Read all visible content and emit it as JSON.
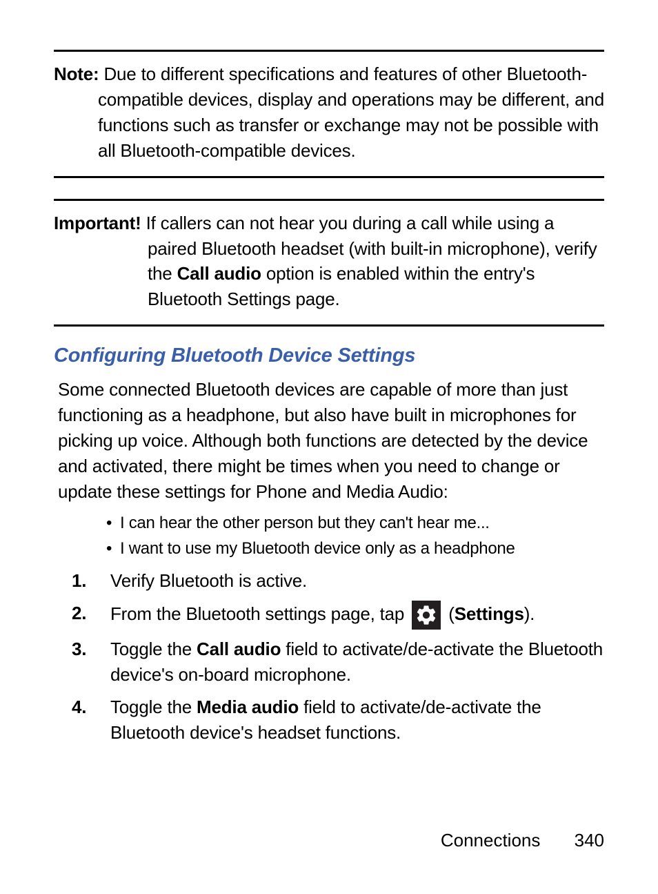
{
  "note": {
    "label": "Note:",
    "line1_after": " Due to different specifications and features of other Bluetooth-",
    "line2": "compatible devices, display and operations may be different, and functions such as transfer or exchange may not be possible with all Bluetooth-compatible devices."
  },
  "important": {
    "label": "Important!",
    "line1_after": " If callers can not hear you during a call while using a",
    "line2_before": "paired Bluetooth headset (with built-in microphone), verify the ",
    "call_audio": "Call audio",
    "line2_after": " option is enabled within the entry's Bluetooth Settings page."
  },
  "heading": "Configuring Bluetooth Device Settings",
  "intro": "Some connected Bluetooth devices are capable of more than just functioning as a headphone, but also have built in microphones for picking up voice. Although both functions are detected by the device and activated, there might be times when you need to change or update these settings for Phone and Media Audio:",
  "bullets": [
    "I can hear the other person but they can't hear me...",
    "I want to use my Bluetooth device only as a headphone"
  ],
  "steps": {
    "s1": {
      "num": "1.",
      "text": "Verify Bluetooth is active."
    },
    "s2": {
      "num": "2.",
      "before": "From the Bluetooth settings page, tap ",
      "paren_open": " (",
      "settings_bold": "Settings",
      "paren_close": ")."
    },
    "s3": {
      "num": "3.",
      "before": "Toggle the ",
      "bold": "Call audio",
      "after": " field to activate/de-activate the Bluetooth device's on-board microphone."
    },
    "s4": {
      "num": "4.",
      "before": "Toggle the ",
      "bold": "Media audio",
      "after": " field to activate/de-activate the Bluetooth device's headset functions."
    }
  },
  "footer": {
    "section": "Connections",
    "page": "340"
  }
}
